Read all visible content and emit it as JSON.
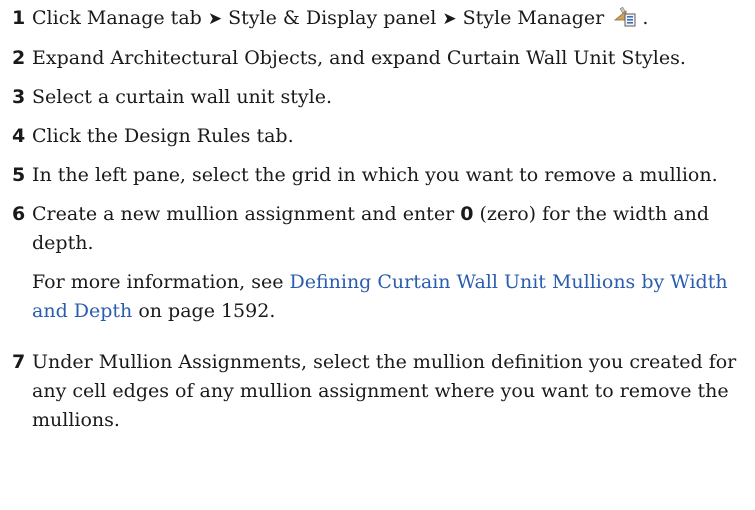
{
  "steps": [
    {
      "num": "1",
      "parts": {
        "a": "Click Manage tab",
        "arrow1": "➤",
        "b": "Style & Display panel",
        "arrow2": "➤",
        "c": "Style Manager",
        "end": "."
      },
      "icon": "style-manager-icon"
    },
    {
      "num": "2",
      "text": "Expand Architectural Objects, and expand Curtain Wall Unit Styles."
    },
    {
      "num": "3",
      "text": "Select a curtain wall unit style."
    },
    {
      "num": "4",
      "text": "Click the Design Rules tab."
    },
    {
      "num": "5",
      "text": "In the left pane, select the grid in which you want to remove a mullion."
    },
    {
      "num": "6",
      "text_before": "Create a new mullion assignment and enter ",
      "bold": "0",
      "text_after": " (zero) for the width and depth.",
      "sub_before": "For more information, see ",
      "link": "Defining Curtain Wall Unit Mullions by Width and Depth",
      "sub_after": " on page 1592."
    },
    {
      "num": "7",
      "text": "Under Mullion Assignments, select the mullion definition you created for any cell edges of any mullion assignment where you want to remove the mullions."
    }
  ],
  "colors": {
    "link": "#2a5db0",
    "text": "#1a1a1a"
  }
}
